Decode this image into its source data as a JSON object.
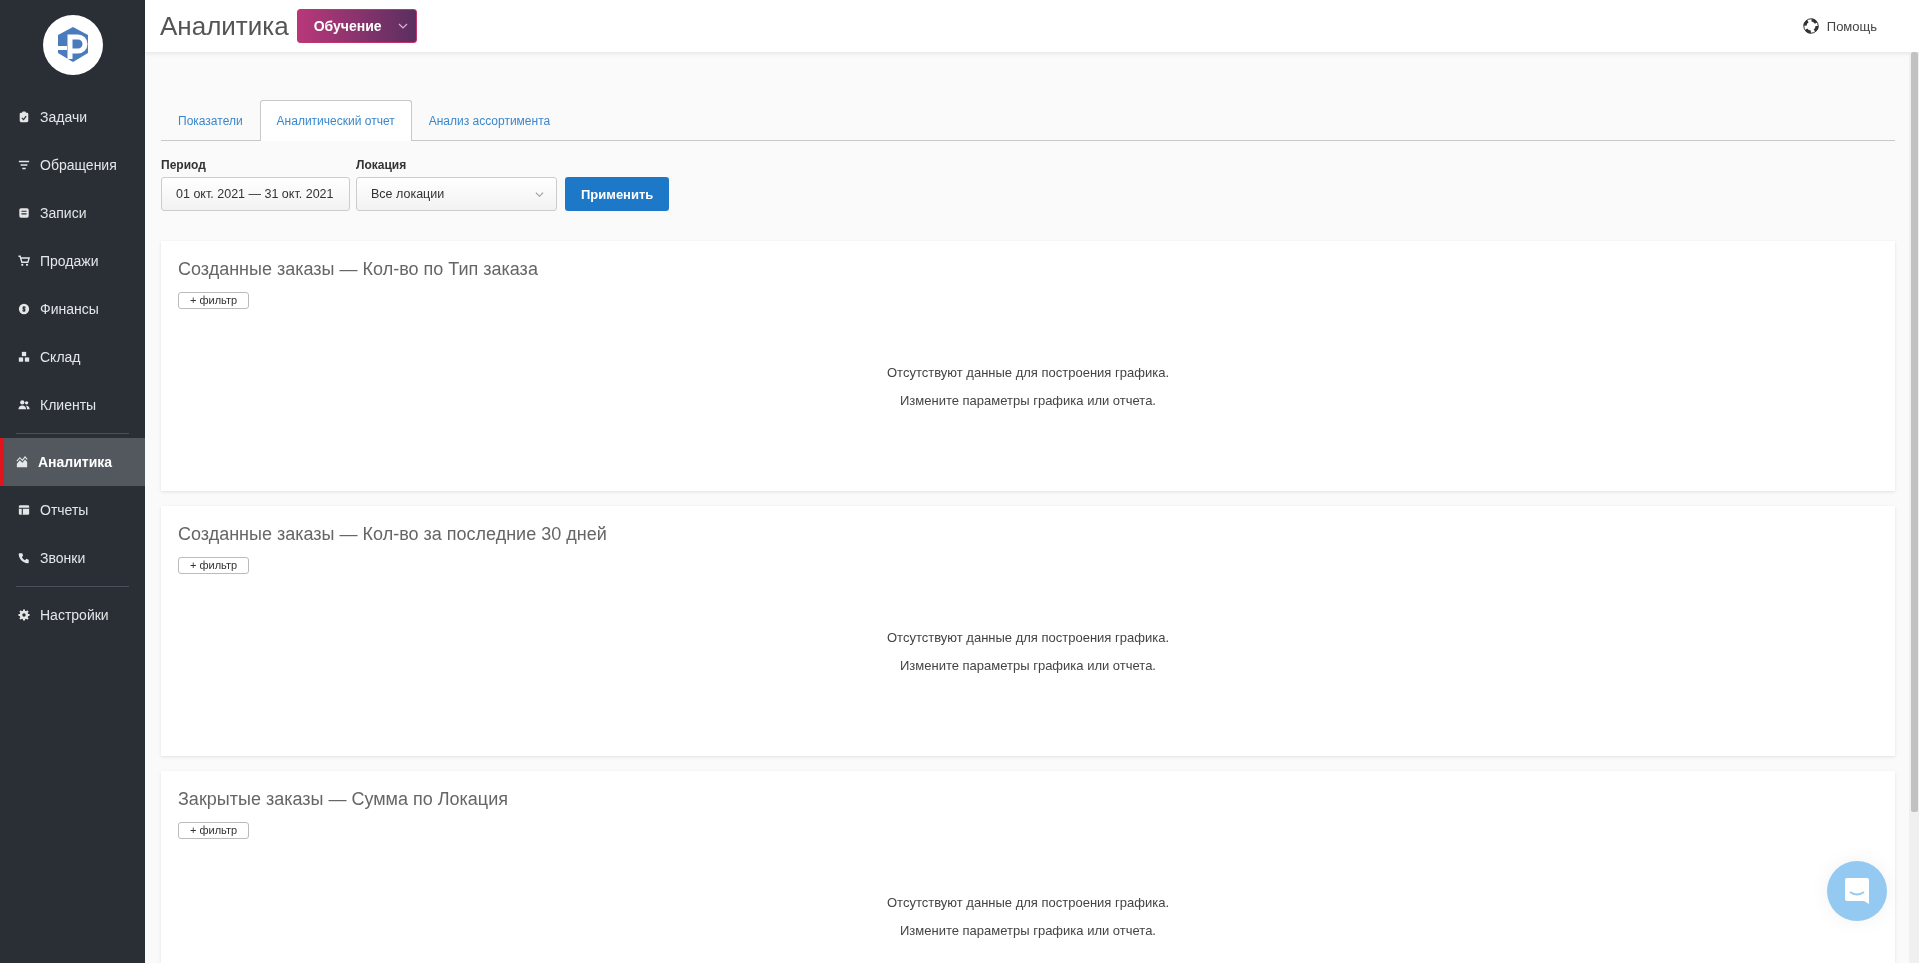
{
  "sidebar": {
    "groups": [
      {
        "items": [
          {
            "kind": "tasks",
            "label": "Задачи",
            "selected": false
          },
          {
            "kind": "requests",
            "label": "Обращения",
            "selected": false
          },
          {
            "kind": "records",
            "label": "Записи",
            "selected": false
          },
          {
            "kind": "sales",
            "label": "Продажи",
            "selected": false
          },
          {
            "kind": "finance",
            "label": "Финансы",
            "selected": false
          },
          {
            "kind": "warehouse",
            "label": "Склад",
            "selected": false
          },
          {
            "kind": "clients",
            "label": "Клиенты",
            "selected": false
          }
        ]
      },
      {
        "items": [
          {
            "kind": "analytics",
            "label": "Аналитика",
            "selected": true
          },
          {
            "kind": "reports",
            "label": "Отчеты",
            "selected": false
          },
          {
            "kind": "calls",
            "label": "Звонки",
            "selected": false
          }
        ]
      },
      {
        "items": [
          {
            "kind": "settings",
            "label": "Настройки",
            "selected": false
          }
        ]
      }
    ]
  },
  "header": {
    "title": "Аналитика",
    "training_button": "Обучение",
    "help": "Помощь"
  },
  "tabs": [
    {
      "label": "Показатели",
      "selected": false
    },
    {
      "label": "Аналитический отчет",
      "selected": true
    },
    {
      "label": "Анализ ассортимента",
      "selected": false
    }
  ],
  "filters": {
    "period": {
      "label": "Период",
      "value": "01 окт. 2021 — 31 окт. 2021"
    },
    "location": {
      "label": "Локация",
      "value": "Все локации"
    },
    "apply_button": "Применить"
  },
  "cards": [
    {
      "title": "Созданные заказы — Кол-во по Тип заказа",
      "filter_button": "+ фильтр",
      "empty_message": [
        "Отсутствуют данные для построения графика.",
        "Измените параметры графика или отчета."
      ]
    },
    {
      "title": "Созданные заказы — Кол-во за последние 30 дней",
      "filter_button": "+ фильтр",
      "empty_message": [
        "Отсутствуют данные для построения графика.",
        "Измените параметры графика или отчета."
      ]
    },
    {
      "title": "Закрытые заказы — Сумма по Локация",
      "filter_button": "+ фильтр",
      "empty_message": [
        "Отсутствуют данные для построения графика.",
        "Измените параметры графика или отчета."
      ]
    }
  ]
}
